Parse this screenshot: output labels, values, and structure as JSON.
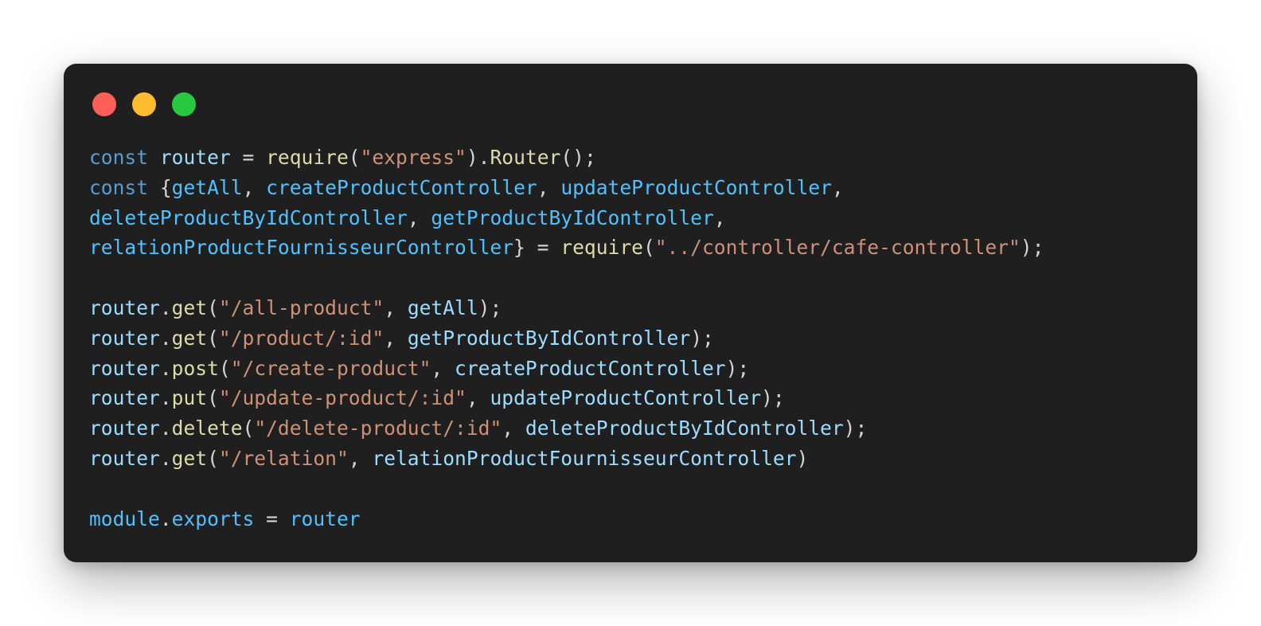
{
  "window": {
    "buttons": [
      {
        "name": "close",
        "color": "#ff5f57"
      },
      {
        "name": "minimize",
        "color": "#febc2e"
      },
      {
        "name": "maximize",
        "color": "#28c840"
      }
    ]
  },
  "code": {
    "language": "javascript",
    "lines": [
      [
        {
          "t": "const",
          "k": "keyword"
        },
        {
          "t": " ",
          "k": "plain"
        },
        {
          "t": "router",
          "k": "variable"
        },
        {
          "t": " = ",
          "k": "plain"
        },
        {
          "t": "require",
          "k": "function"
        },
        {
          "t": "(",
          "k": "plain"
        },
        {
          "t": "\"express\"",
          "k": "string"
        },
        {
          "t": ").",
          "k": "plain"
        },
        {
          "t": "Router",
          "k": "function"
        },
        {
          "t": "();",
          "k": "plain"
        }
      ],
      [
        {
          "t": "const",
          "k": "keyword"
        },
        {
          "t": " {",
          "k": "plain"
        },
        {
          "t": "getAll",
          "k": "constant"
        },
        {
          "t": ", ",
          "k": "plain"
        },
        {
          "t": "createProductController",
          "k": "constant"
        },
        {
          "t": ", ",
          "k": "plain"
        },
        {
          "t": "updateProductController",
          "k": "constant"
        },
        {
          "t": ",",
          "k": "plain"
        }
      ],
      [
        {
          "t": "deleteProductByIdController",
          "k": "constant"
        },
        {
          "t": ", ",
          "k": "plain"
        },
        {
          "t": "getProductByIdController",
          "k": "constant"
        },
        {
          "t": ",",
          "k": "plain"
        }
      ],
      [
        {
          "t": "relationProductFournisseurController",
          "k": "constant"
        },
        {
          "t": "} = ",
          "k": "plain"
        },
        {
          "t": "require",
          "k": "function"
        },
        {
          "t": "(",
          "k": "plain"
        },
        {
          "t": "\"../controller/cafe-controller\"",
          "k": "string"
        },
        {
          "t": ");",
          "k": "plain"
        }
      ],
      [],
      [
        {
          "t": "router",
          "k": "variable"
        },
        {
          "t": ".",
          "k": "plain"
        },
        {
          "t": "get",
          "k": "function"
        },
        {
          "t": "(",
          "k": "plain"
        },
        {
          "t": "\"/all-product\"",
          "k": "string"
        },
        {
          "t": ", ",
          "k": "plain"
        },
        {
          "t": "getAll",
          "k": "variable"
        },
        {
          "t": ");",
          "k": "plain"
        }
      ],
      [
        {
          "t": "router",
          "k": "variable"
        },
        {
          "t": ".",
          "k": "plain"
        },
        {
          "t": "get",
          "k": "function"
        },
        {
          "t": "(",
          "k": "plain"
        },
        {
          "t": "\"/product/:id\"",
          "k": "string"
        },
        {
          "t": ", ",
          "k": "plain"
        },
        {
          "t": "getProductByIdController",
          "k": "variable"
        },
        {
          "t": ");",
          "k": "plain"
        }
      ],
      [
        {
          "t": "router",
          "k": "variable"
        },
        {
          "t": ".",
          "k": "plain"
        },
        {
          "t": "post",
          "k": "function"
        },
        {
          "t": "(",
          "k": "plain"
        },
        {
          "t": "\"/create-product\"",
          "k": "string"
        },
        {
          "t": ", ",
          "k": "plain"
        },
        {
          "t": "createProductController",
          "k": "variable"
        },
        {
          "t": ");",
          "k": "plain"
        }
      ],
      [
        {
          "t": "router",
          "k": "variable"
        },
        {
          "t": ".",
          "k": "plain"
        },
        {
          "t": "put",
          "k": "function"
        },
        {
          "t": "(",
          "k": "plain"
        },
        {
          "t": "\"/update-product/:id\"",
          "k": "string"
        },
        {
          "t": ", ",
          "k": "plain"
        },
        {
          "t": "updateProductController",
          "k": "variable"
        },
        {
          "t": ");",
          "k": "plain"
        }
      ],
      [
        {
          "t": "router",
          "k": "variable"
        },
        {
          "t": ".",
          "k": "plain"
        },
        {
          "t": "delete",
          "k": "function"
        },
        {
          "t": "(",
          "k": "plain"
        },
        {
          "t": "\"/delete-product/:id\"",
          "k": "string"
        },
        {
          "t": ", ",
          "k": "plain"
        },
        {
          "t": "deleteProductByIdController",
          "k": "variable"
        },
        {
          "t": ");",
          "k": "plain"
        }
      ],
      [
        {
          "t": "router",
          "k": "variable"
        },
        {
          "t": ".",
          "k": "plain"
        },
        {
          "t": "get",
          "k": "function"
        },
        {
          "t": "(",
          "k": "plain"
        },
        {
          "t": "\"/relation\"",
          "k": "string"
        },
        {
          "t": ", ",
          "k": "plain"
        },
        {
          "t": "relationProductFournisseurController",
          "k": "variable"
        },
        {
          "t": ")",
          "k": "plain"
        }
      ],
      [],
      [
        {
          "t": "module",
          "k": "constant"
        },
        {
          "t": ".",
          "k": "plain"
        },
        {
          "t": "exports",
          "k": "constant"
        },
        {
          "t": " = ",
          "k": "plain"
        },
        {
          "t": "router",
          "k": "constant"
        }
      ]
    ]
  }
}
